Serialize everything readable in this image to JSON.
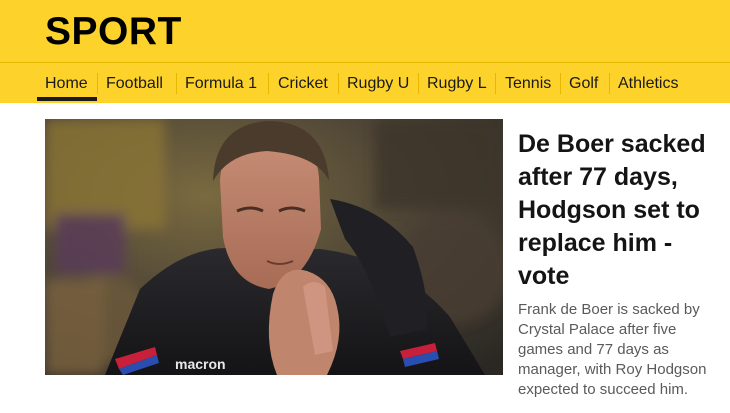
{
  "header": {
    "logo": "SPORT"
  },
  "nav": {
    "items": [
      {
        "label": "Home",
        "active": true
      },
      {
        "label": "Football"
      },
      {
        "label": "Formula 1"
      },
      {
        "label": "Cricket"
      },
      {
        "label": "Rugby U"
      },
      {
        "label": "Rugby L"
      },
      {
        "label": "Tennis"
      },
      {
        "label": "Golf"
      },
      {
        "label": "Athletics"
      }
    ]
  },
  "story": {
    "headline": "De Boer sacked after 77 days, Hodgson set to replace him - vote",
    "summary": "Frank de Boer is sacked by Crystal Palace after five games and 77 days as manager, with Roy Hodgson expected to succeed him.",
    "image_alt": "Frank de Boer"
  },
  "colors": {
    "brand_yellow": "#fdd22a",
    "text": "#141414",
    "summary_text": "#5a5a5a"
  }
}
